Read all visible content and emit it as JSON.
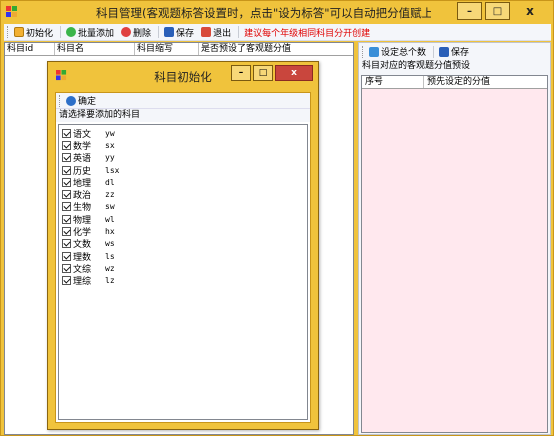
{
  "window": {
    "title": "科目管理(客观题标答设置时，点击\"设为标答\"可以自动把分值赋上)",
    "min_icon": "minimize-icon",
    "max_icon": "maximize-icon",
    "close_icon": "close-icon",
    "min_glyph": "–",
    "max_glyph": "□",
    "close_glyph": "x"
  },
  "toolbar": {
    "init_label": "初始化",
    "batch_add_label": "批量添加",
    "delete_label": "删除",
    "save_label": "保存",
    "exit_label": "退出",
    "hint": "建议每个年级相同科目分开创建"
  },
  "left_grid": {
    "columns": [
      "科目id",
      "科目名",
      "科目缩写",
      "是否预设了客观题分值"
    ]
  },
  "right_panel": {
    "set_count_label": "设定总个数",
    "save_label": "保存",
    "section_label": "科目对应的客观题分值预设",
    "columns": [
      "序号",
      "预先设定的分值"
    ]
  },
  "dialog": {
    "title": "科目初始化",
    "confirm_label": "确定",
    "prompt": "请选择要添加的科目",
    "min_glyph": "–",
    "max_glyph": "□",
    "close_glyph": "x",
    "items": [
      {
        "name": "语文",
        "code": "yw",
        "checked": true
      },
      {
        "name": "数学",
        "code": "sx",
        "checked": true
      },
      {
        "name": "英语",
        "code": "yy",
        "checked": true
      },
      {
        "name": "历史",
        "code": "lsx",
        "checked": true
      },
      {
        "name": "地理",
        "code": "dl",
        "checked": true
      },
      {
        "name": "政治",
        "code": "zz",
        "checked": true
      },
      {
        "name": "生物",
        "code": "sw",
        "checked": true
      },
      {
        "name": "物理",
        "code": "wl",
        "checked": true
      },
      {
        "name": "化学",
        "code": "hx",
        "checked": true
      },
      {
        "name": "文数",
        "code": "ws",
        "checked": true
      },
      {
        "name": "理数",
        "code": "ls",
        "checked": true
      },
      {
        "name": "文综",
        "code": "wz",
        "checked": true
      },
      {
        "name": "理综",
        "code": "lz",
        "checked": true
      }
    ]
  },
  "colors": {
    "frame": "#f0c33c",
    "hint_red": "#e00000",
    "right_grid_bg": "#ffe8ee",
    "close_red": "#c9463d"
  }
}
